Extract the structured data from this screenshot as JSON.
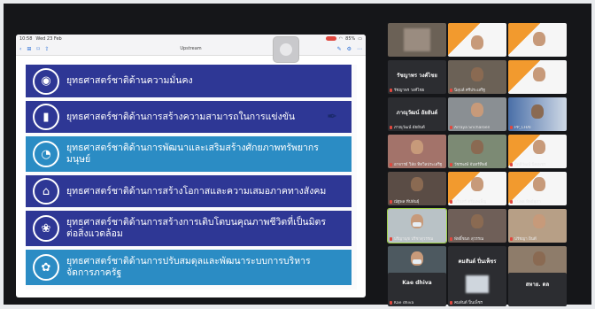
{
  "status": {
    "time": "10:58",
    "date": "Wed 23 Feb",
    "battery": "85%"
  },
  "toolbar": {
    "title": "Upstream"
  },
  "slide_items": [
    {
      "label": "ยุทธศาสตร์ชาติด้านความมั่นคง",
      "icon": "security-icon"
    },
    {
      "label": "ยุทธศาสตร์ชาติด้านการสร้างความสามารถในการแข่งขัน",
      "icon": "competitiveness-icon"
    },
    {
      "label": "ยุทธศาสตร์ชาติด้านการพัฒนาและเสริมสร้างศักยภาพทรัพยากรมนุษย์",
      "icon": "human-resource-icon"
    },
    {
      "label": "ยุทธศาสตร์ชาติด้านการสร้างโอกาสและความเสมอภาคทางสังคม",
      "icon": "social-equality-icon"
    },
    {
      "label": "ยุทธศาสตร์ชาติด้านการสร้างการเติบโตบนคุณภาพชีวิตที่เป็นมิตรต่อสิ่งแวดล้อม",
      "icon": "eco-growth-icon"
    },
    {
      "label": "ยุทธศาสตร์ชาติด้านการปรับสมดุลและพัฒนาระบบการบริหารจัดการภาครัฐ",
      "icon": "public-admin-icon"
    }
  ],
  "participants": {
    "tiles": [
      {
        "name": "",
        "caption": ""
      },
      {
        "name": "",
        "caption": ""
      },
      {
        "name": "",
        "caption": ""
      },
      {
        "name": "รัชญาพร วงศ์ไชย",
        "caption": "รัชญาพร วงศ์ไชย"
      },
      {
        "name": "",
        "caption": ""
      },
      {
        "name": "นิลุบล์ ศรีประเสริฐ",
        "caption": ""
      },
      {
        "name": "ภาณุวัฒน์ อัยยันต์",
        "caption": "ภาณุวัฒน์ อัยยันต์"
      },
      {
        "name": "Arraya Sricharoen",
        "caption": ""
      },
      {
        "name": "PP_CHAI",
        "caption": ""
      },
      {
        "name": "อาจารย์ วิลัย ทิตวิลประเสริฐ",
        "caption": ""
      },
      {
        "name": "วัชรพงษ์ จันทร์ทิพย์",
        "caption": ""
      },
      {
        "name": "กิตติวัฒน์ นิลเพชร",
        "caption": ""
      },
      {
        "name": "ณัฐพล ทีปพันธุ์",
        "caption": ""
      },
      {
        "name": "นรินทร์ ตรีณพเพ็ญ",
        "caption": ""
      },
      {
        "name": "ธนพล ทิพย์สุภา",
        "caption": ""
      },
      {
        "name": "ปรีญานุช ปรีชาสุวรรณ",
        "caption": ""
      },
      {
        "name": "พัทธิ์ชนก สุวรรณ",
        "caption": ""
      },
      {
        "name": "ปรัชญา ยินดี",
        "caption": ""
      },
      {
        "name": "รัชฎาภรณ์ กิตติศักดิ์",
        "caption": ""
      },
      {
        "name": "คมสันต์ ปิ่นเพ็ชร",
        "caption": "คมสันต์ ปิ่นเพ็ชร"
      },
      {
        "name": "Thanakrit Kamyuenhe",
        "caption": ""
      },
      {
        "name": "Kae dhiva",
        "caption": "Kae dhiva"
      },
      {
        "name": "คมสันต์ ปิ่นเพ็ชร",
        "caption": ""
      },
      {
        "name": "สหาย. ดล",
        "caption": "สหาย. ดล"
      }
    ]
  }
}
